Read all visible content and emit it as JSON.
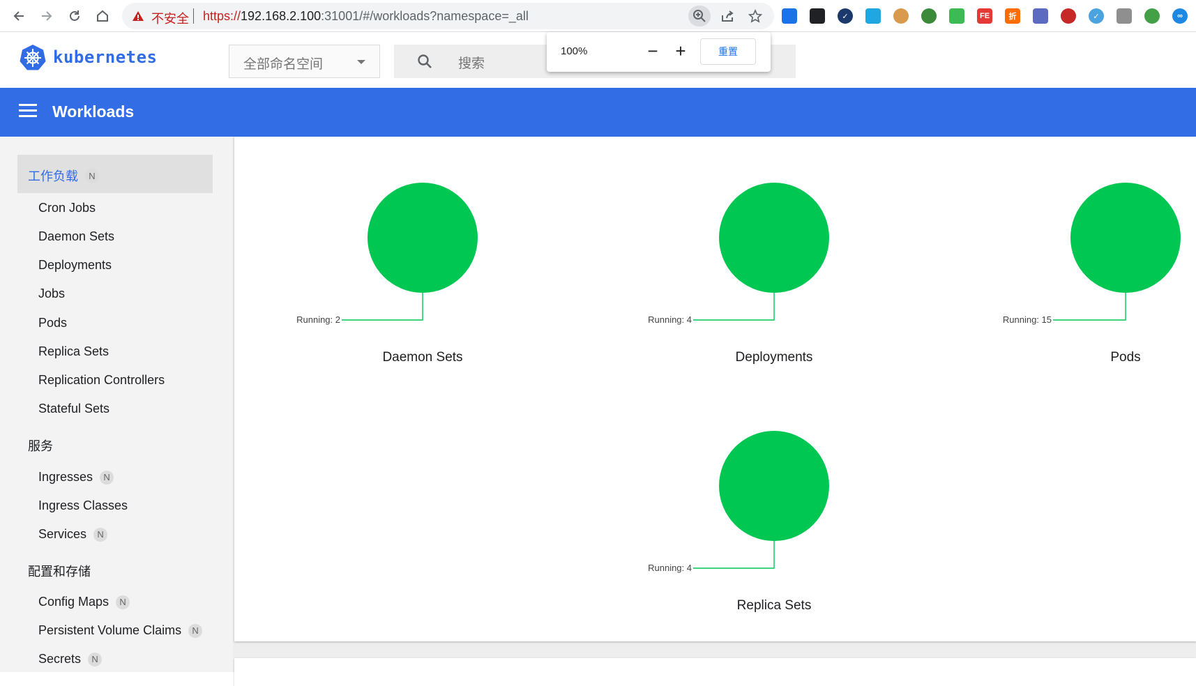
{
  "browser": {
    "insecure_label": "不安全",
    "url_proto": "https://",
    "url_host": "192.168.2.100",
    "url_rest": ":31001/#/workloads?namespace=_all",
    "zoom": {
      "value": "100%",
      "minus": "−",
      "plus": "+",
      "reset": "重置"
    }
  },
  "app": {
    "logo_text": "kubernetes",
    "namespace": "全部命名空间",
    "search_placeholder": "搜索",
    "toolbar_title": "Workloads",
    "brand_color": "#326ce5",
    "status_color": "#00c752"
  },
  "sidebar": {
    "sections": [
      {
        "title": "工作负载",
        "badge": "N",
        "items": [
          {
            "label": "Cron Jobs"
          },
          {
            "label": "Daemon Sets"
          },
          {
            "label": "Deployments"
          },
          {
            "label": "Jobs"
          },
          {
            "label": "Pods"
          },
          {
            "label": "Replica Sets"
          },
          {
            "label": "Replication Controllers"
          },
          {
            "label": "Stateful Sets"
          }
        ]
      },
      {
        "title": "服务",
        "items": [
          {
            "label": "Ingresses",
            "badge": "N"
          },
          {
            "label": "Ingress Classes"
          },
          {
            "label": "Services",
            "badge": "N"
          }
        ]
      },
      {
        "title": "配置和存储",
        "items": [
          {
            "label": "Config Maps",
            "badge": "N"
          },
          {
            "label": "Persistent Volume Claims",
            "badge": "N"
          },
          {
            "label": "Secrets",
            "badge": "N"
          }
        ]
      }
    ]
  },
  "charts": [
    {
      "title": "Daemon Sets",
      "label": "Running: 2",
      "running": 2
    },
    {
      "title": "Deployments",
      "label": "Running: 4",
      "running": 4
    },
    {
      "title": "Pods",
      "label": "Running: 15",
      "running": 15
    },
    {
      "title": "Replica Sets",
      "label": "Running: 4",
      "running": 4
    }
  ]
}
